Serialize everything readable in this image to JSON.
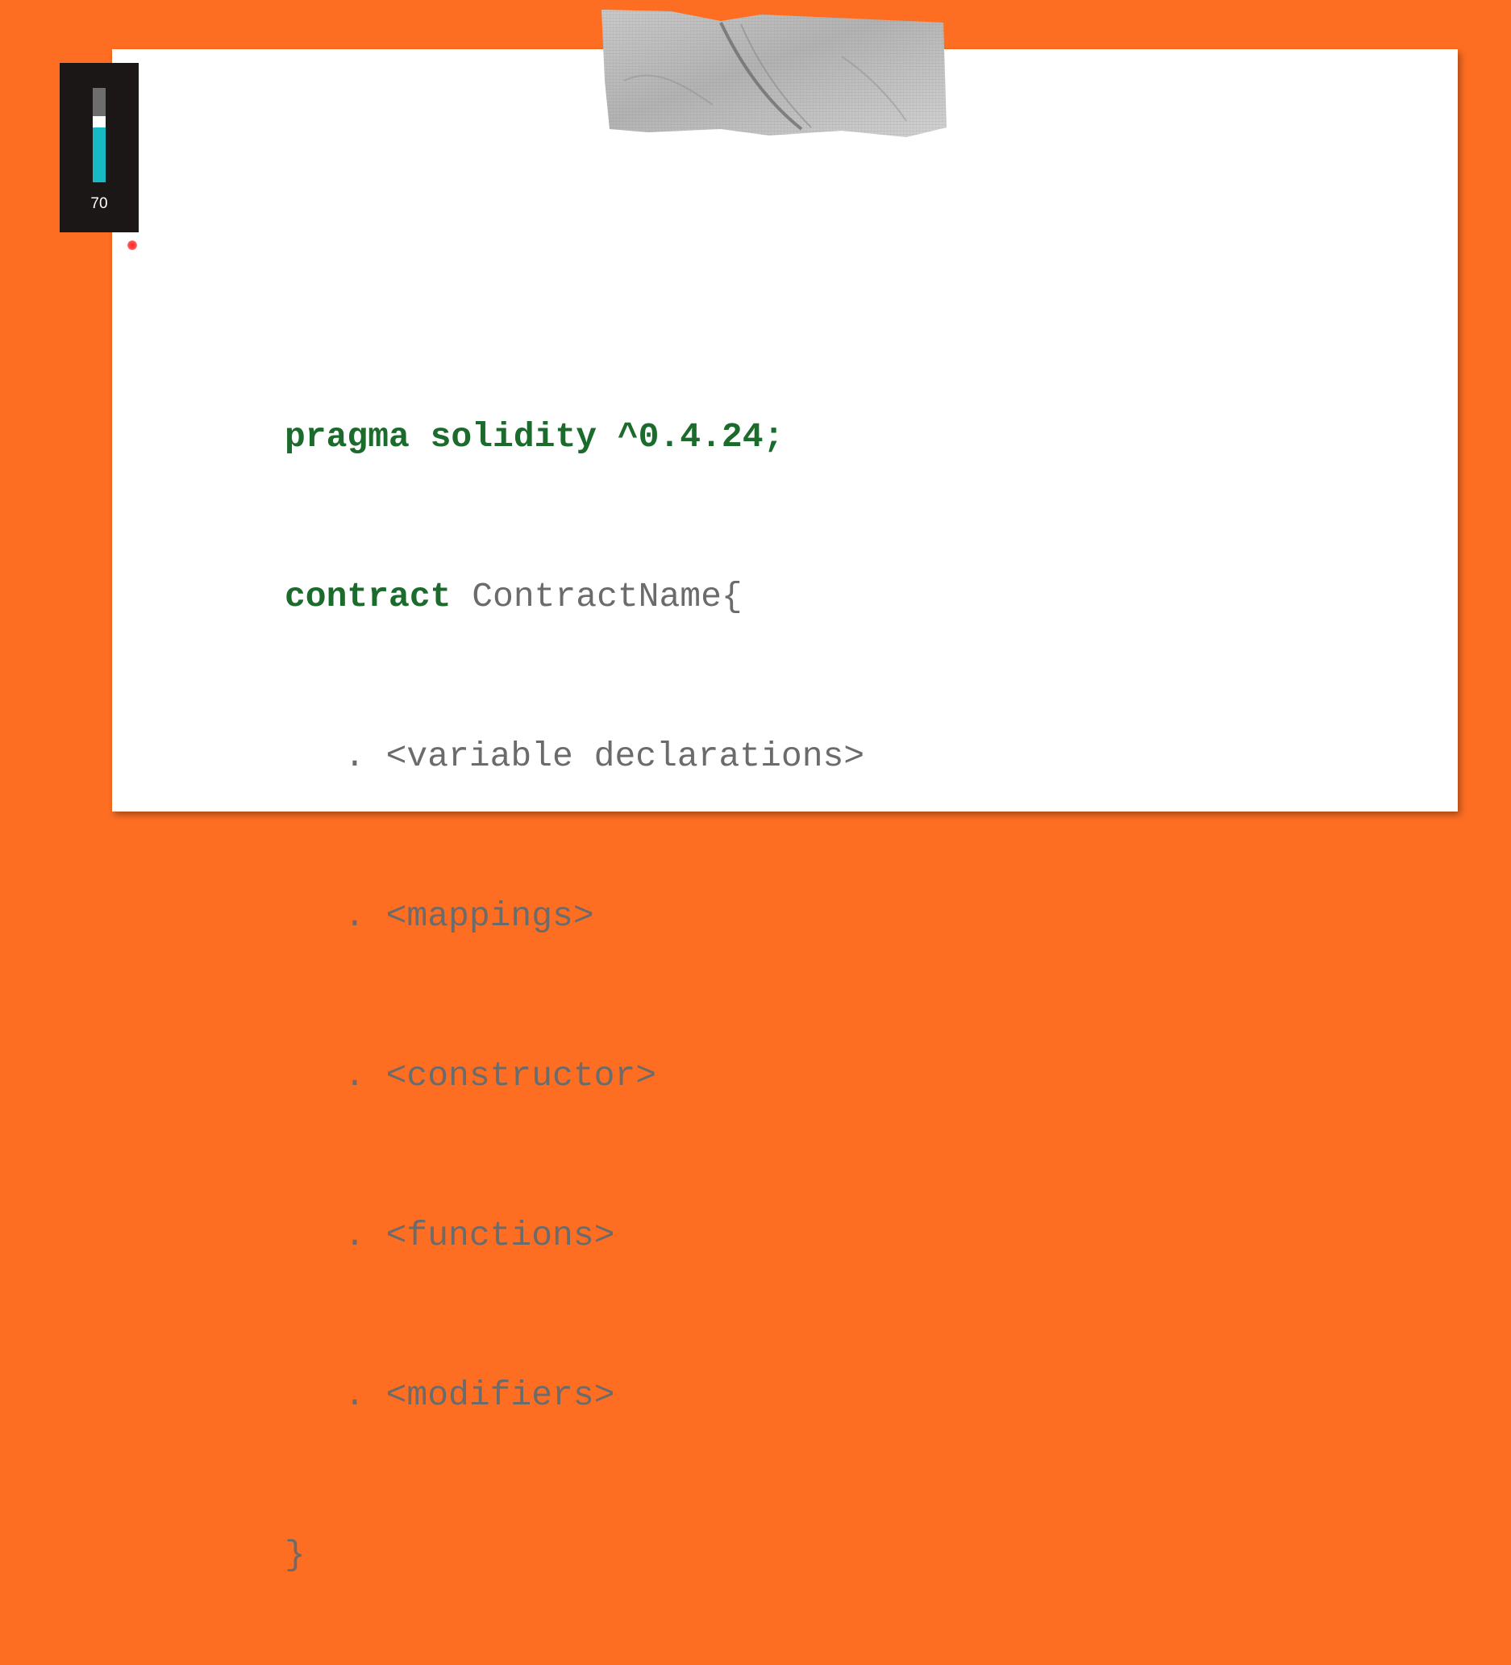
{
  "volume_indicator": {
    "level": 70
  },
  "slide": {
    "pragma_line": "pragma solidity ^0.4.24;",
    "contract_keyword": "contract",
    "contract_name": "ContractName{",
    "items": [
      ". <variable declarations>",
      ". <mappings>",
      ". <constructor>",
      ". <functions>",
      ". <modifiers>"
    ],
    "closing_brace": "}"
  },
  "colors": {
    "background": "#fe6e22",
    "keyword": "#1b6b2c",
    "code_text": "#6b6b6b",
    "volume_fill": "#17b9c4"
  }
}
